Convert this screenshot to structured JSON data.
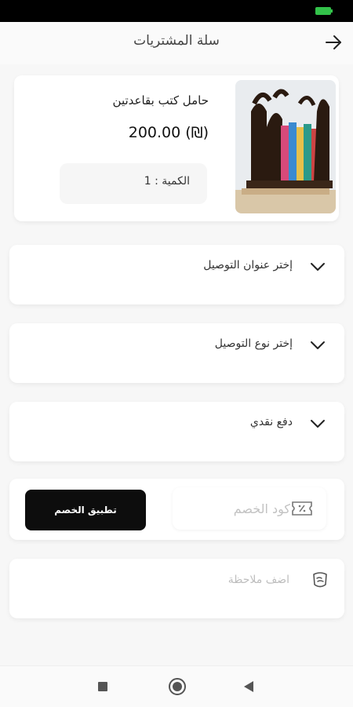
{
  "header": {
    "title": "سلة المشتريات",
    "back_icon": "arrow-right-icon"
  },
  "product": {
    "name": "حامل كتب بقاعدتين",
    "price": "200.00 (₪)",
    "quantity_label": "الكمية : 1"
  },
  "dropdowns": [
    {
      "label": "إختر عنوان التوصيل"
    },
    {
      "label": "إختر نوع التوصيل"
    },
    {
      "label": "دفع نقدي"
    }
  ],
  "discount": {
    "placeholder": "كود الخصم",
    "apply_label": "تطبيق الخصم",
    "icon": "coupon-icon"
  },
  "note": {
    "placeholder": "اضف ملاحظة",
    "icon": "note-icon"
  },
  "navbar": {
    "icons": [
      "square-icon",
      "home-circle-icon",
      "back-triangle-icon"
    ]
  },
  "colors": {
    "background": "#f7f7f7",
    "card": "#ffffff",
    "button": "#0d0d0d",
    "battery": "#33c24a"
  }
}
